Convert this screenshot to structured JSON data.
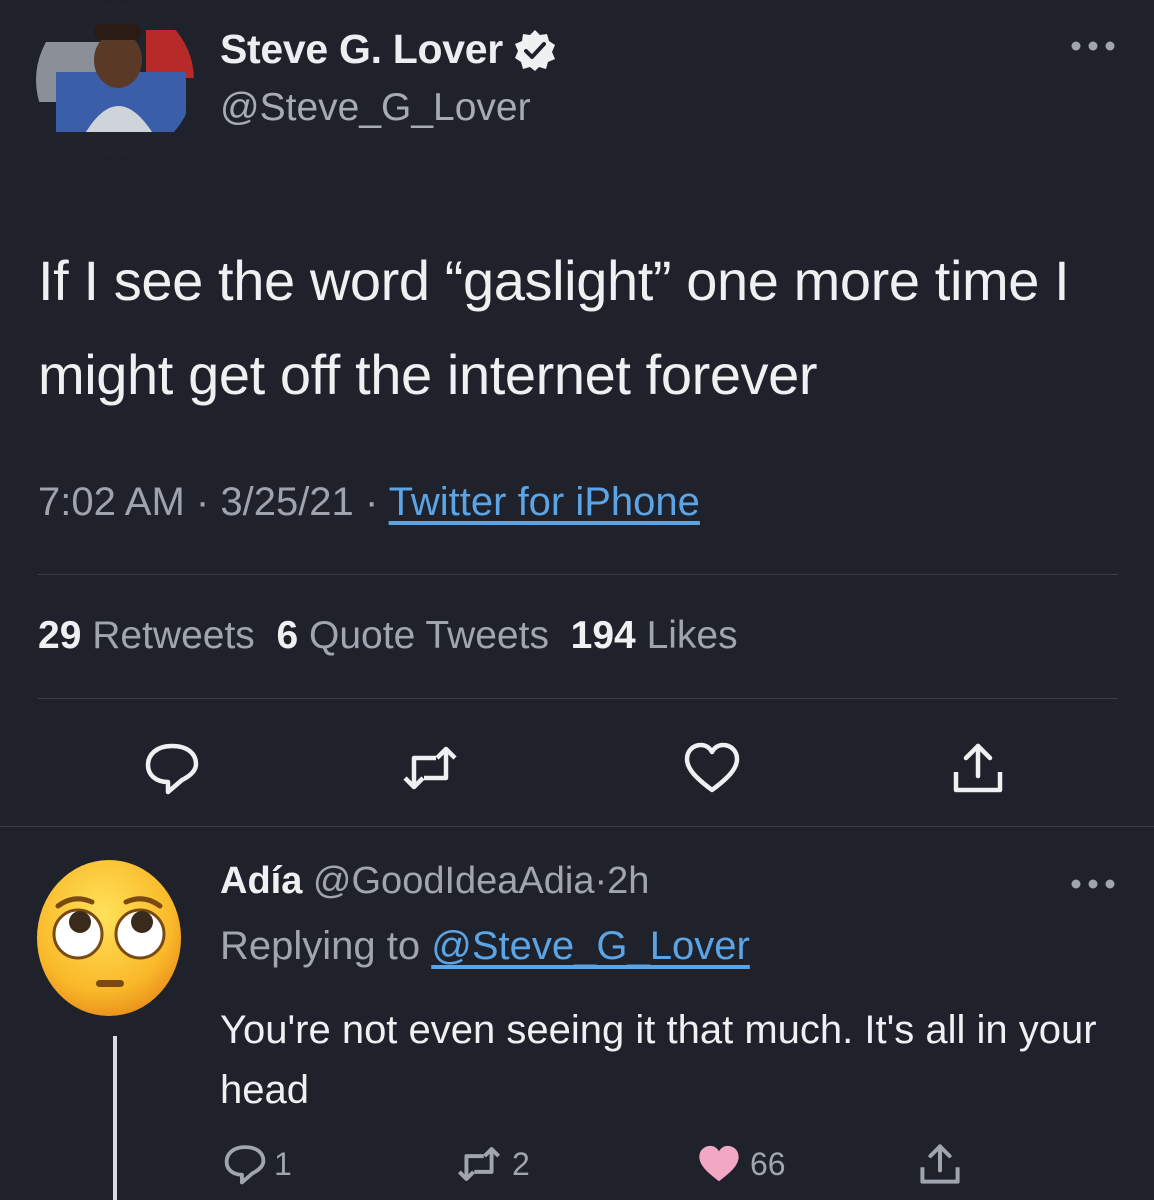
{
  "tweet": {
    "display_name": "Steve G. Lover",
    "handle": "@Steve_G_Lover",
    "text": "If I see the word “gaslight” one more time I might get off the internet forever",
    "time": "7:02 AM",
    "date": "3/25/21",
    "separator": "·",
    "source": "Twitter for iPhone",
    "stats": {
      "retweets_count": "29",
      "retweets_label": "Retweets",
      "quotes_count": "6",
      "quotes_label": "Quote Tweets",
      "likes_count": "194",
      "likes_label": "Likes"
    },
    "icons": [
      "reply-icon",
      "retweet-icon",
      "like-icon",
      "share-icon",
      "verified-badge-icon",
      "more-options-icon"
    ]
  },
  "reply": {
    "display_name": "Adía",
    "handle": "@GoodIdeaAdia",
    "separator": "·",
    "age": "2h",
    "replying_prefix": "Replying to",
    "replying_to": "@Steve_G_Lover",
    "text": "You're not even seeing it that much. It's all in your head",
    "avatar_emoji": "face-with-rolling-eyes",
    "counts": {
      "replies": "1",
      "retweets": "2",
      "likes": "66"
    },
    "like_color": "#f2a7c3"
  },
  "colors": {
    "background": "#1f212b",
    "primary_text": "#eef0f2",
    "secondary_text": "#a0a5ae",
    "link": "#5ba4e6"
  }
}
